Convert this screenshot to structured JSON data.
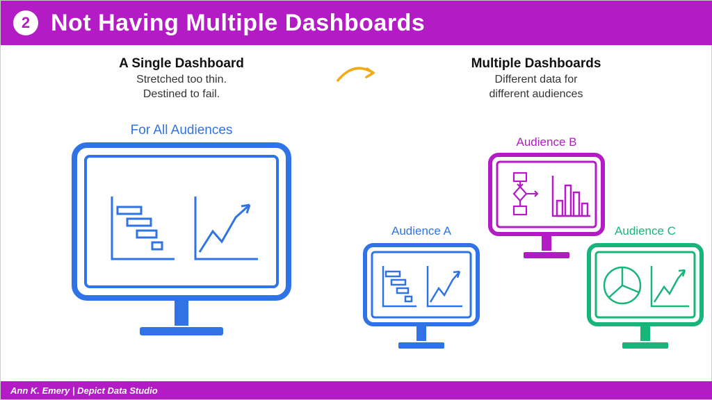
{
  "header": {
    "badge": "2",
    "title": "Not Having Multiple Dashboards"
  },
  "left": {
    "heading": "A Single Dashboard",
    "desc_line1": "Stretched too thin.",
    "desc_line2": "Destined to fail.",
    "monitor_label": "For All Audiences"
  },
  "right": {
    "heading": "Multiple Dashboards",
    "desc_line1": "Different data for",
    "desc_line2": "different audiences",
    "audience_a": "Audience A",
    "audience_b": "Audience B",
    "audience_c": "Audience C"
  },
  "footer": "Ann K. Emery  |  Depict Data Studio",
  "colors": {
    "purple": "#b31bc4",
    "blue": "#2f73e6",
    "green": "#18b57a",
    "arrow": "#f2a915"
  }
}
